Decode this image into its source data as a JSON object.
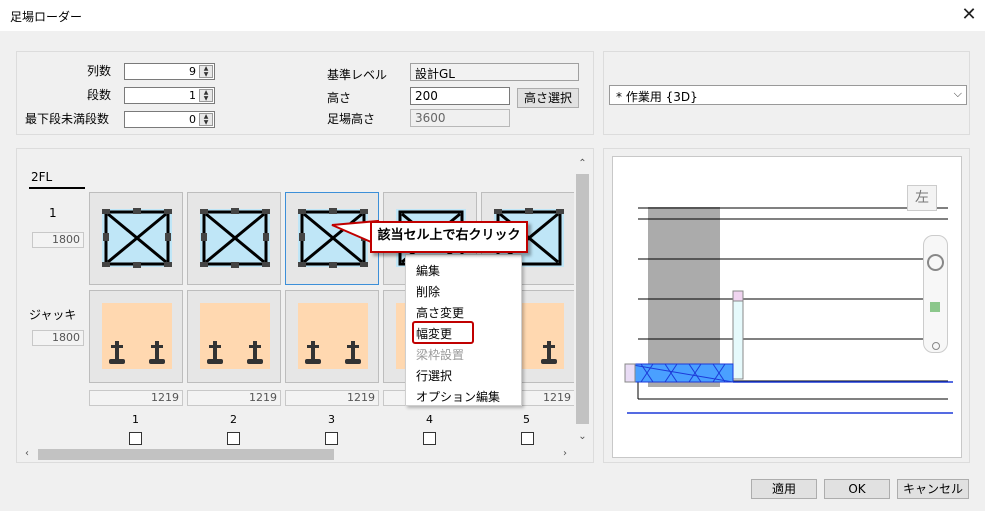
{
  "window": {
    "title": "足場ローダー",
    "close_glyph": "✕"
  },
  "settings": {
    "columns_label": "列数",
    "columns_value": "9",
    "rows_label": "段数",
    "rows_value": "1",
    "bottom_partial_label": "最下段未満段数",
    "bottom_partial_value": "0",
    "base_level_label": "基準レベル",
    "base_level_value": "設計GL",
    "height_label": "高さ",
    "height_value": "200",
    "height_select_button": "高さ選択",
    "scaffold_height_label": "足場高さ",
    "scaffold_height_value": "3600"
  },
  "view_select": {
    "value": "* 作業用 {3D}"
  },
  "grid": {
    "floor_tab": "2FL",
    "row1_label": "1",
    "row1_height": "1800",
    "jack_label": "ジャッキ",
    "jack_height": "1800",
    "widths": [
      "1219",
      "1219",
      "1219",
      "1219",
      "1219"
    ],
    "column_numbers": [
      "1",
      "2",
      "3",
      "4",
      "5"
    ]
  },
  "context_menu": {
    "items": [
      "編集",
      "削除",
      "高さ変更",
      "幅変更",
      "梁枠設置",
      "行選択",
      "オプション編集"
    ],
    "highlighted": "幅変更",
    "disabled": "梁枠設置"
  },
  "callout": {
    "text": "該当セル上で右クリック"
  },
  "preview": {
    "view_label": "左"
  },
  "footer": {
    "apply": "適用",
    "ok": "OK",
    "cancel": "キャンセル"
  },
  "colors": {
    "frame_bg": "#bfe6f7",
    "jack_bg": "#ffd8b0",
    "accent_red": "#c00000",
    "selection_blue": "#3c8fd8"
  }
}
